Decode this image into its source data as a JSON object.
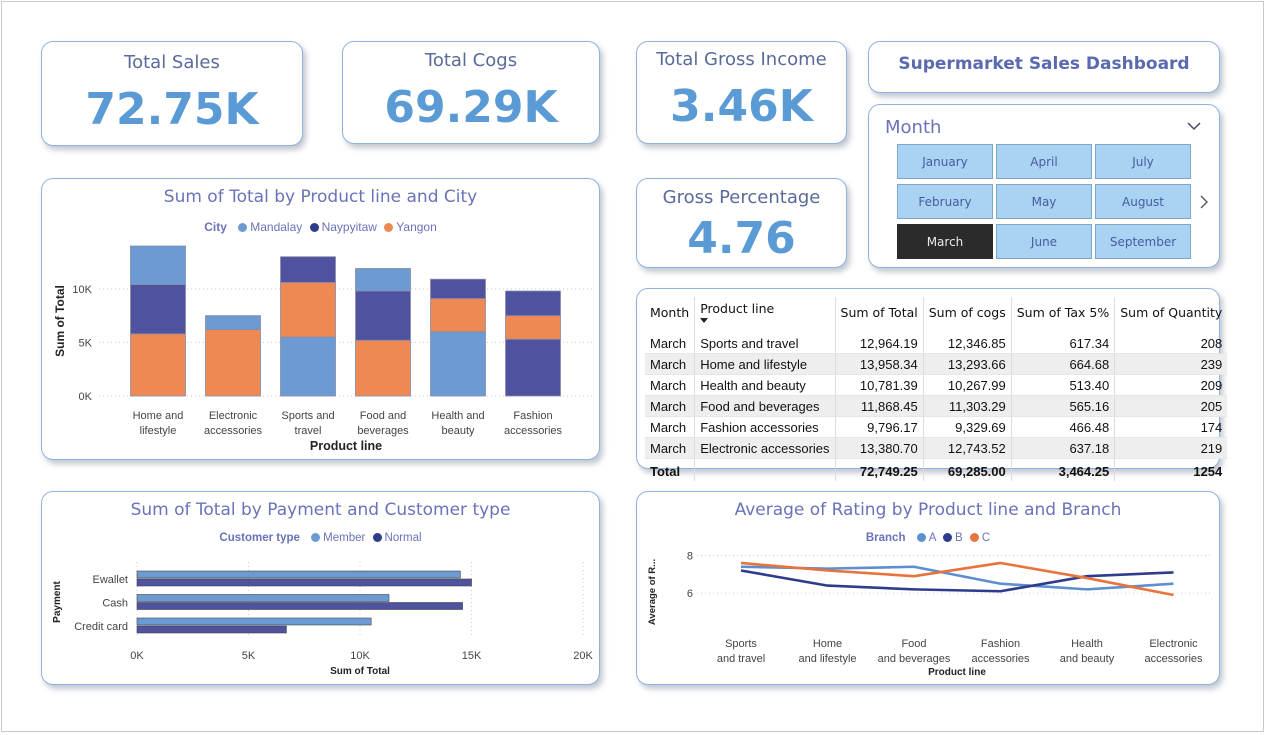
{
  "kpis": {
    "total_sales": {
      "title": "Total Sales",
      "value": "72.75K"
    },
    "total_cogs": {
      "title": "Total Cogs",
      "value": "69.29K"
    },
    "total_gross_income": {
      "title": "Total Gross Income",
      "value": "3.46K"
    },
    "gross_percentage": {
      "title": "Gross Percentage",
      "value": "4.76"
    }
  },
  "dashboard_title": "Supermarket Sales Dashboard",
  "slicer": {
    "title": "Month",
    "options": [
      "January",
      "April",
      "July",
      "February",
      "May",
      "August",
      "March",
      "June",
      "September"
    ],
    "selected": "March"
  },
  "colors": {
    "light_blue": "#6b9bd2",
    "navy": "#4f529f",
    "orange": "#ee8953",
    "line_a": "#5b8fd0",
    "line_b": "#2d3c8c",
    "line_c": "#e8733d"
  },
  "table": {
    "headers": [
      "Month",
      "Product line",
      "Sum of Total",
      "Sum of cogs",
      "Sum of Tax 5%",
      "Sum of Quantity"
    ],
    "rows": [
      [
        "March",
        "Sports and travel",
        "12,964.19",
        "12,346.85",
        "617.34",
        "208"
      ],
      [
        "March",
        "Home and lifestyle",
        "13,958.34",
        "13,293.66",
        "664.68",
        "239"
      ],
      [
        "March",
        "Health and beauty",
        "10,781.39",
        "10,267.99",
        "513.40",
        "209"
      ],
      [
        "March",
        "Food and beverages",
        "11,868.45",
        "11,303.29",
        "565.16",
        "205"
      ],
      [
        "March",
        "Fashion accessories",
        "9,796.17",
        "9,329.69",
        "466.48",
        "174"
      ],
      [
        "March",
        "Electronic accessories",
        "13,380.70",
        "12,743.52",
        "637.18",
        "219"
      ]
    ],
    "total": [
      "Total",
      "",
      "72,749.25",
      "69,285.00",
      "3,464.25",
      "1254"
    ]
  },
  "chart_data": [
    {
      "type": "bar",
      "stacked": true,
      "title": "Sum of Total by Product line and City",
      "legend_title": "City",
      "legend_position": "top",
      "categories": [
        "Home and lifestyle",
        "Electronic accessories",
        "Sports and travel",
        "Food and beverages",
        "Health and beauty",
        "Fashion accessories"
      ],
      "series": [
        {
          "name": "Yangon",
          "values": [
            5800,
            6200,
            0,
            5200,
            0,
            0
          ]
        },
        {
          "name": "Naypyitaw",
          "values": [
            4600,
            0,
            0,
            4600,
            0,
            5300
          ]
        },
        {
          "name": "Mandalay",
          "values": [
            3600,
            1300,
            0,
            2100,
            0,
            0
          ]
        },
        {
          "name": "Mandalay",
          "values": [
            0,
            0,
            5500,
            0,
            6000,
            0
          ]
        },
        {
          "name": "Yangon",
          "values": [
            0,
            0,
            5100,
            0,
            3100,
            2200
          ]
        },
        {
          "name": "Naypyitaw",
          "values": [
            0,
            0,
            2400,
            0,
            1800,
            2300
          ]
        }
      ],
      "xlabel": "Product line",
      "ylabel": "Sum of Total",
      "yticks": [
        "0K",
        "5K",
        "10K"
      ],
      "ylim": [
        0,
        14000
      ],
      "grid": true
    },
    {
      "type": "bar",
      "orientation": "horizontal",
      "title": "Sum of Total by Payment and Customer type",
      "legend_title": "Customer type",
      "legend_position": "top",
      "categories": [
        "Ewallet",
        "Cash",
        "Credit card"
      ],
      "series": [
        {
          "name": "Member",
          "values": [
            14500,
            11300,
            10500
          ]
        },
        {
          "name": "Normal",
          "values": [
            15000,
            14600,
            6700
          ]
        }
      ],
      "xlabel": "Sum of Total",
      "ylabel": "Payment",
      "xticks": [
        "0K",
        "5K",
        "10K",
        "15K",
        "20K"
      ],
      "xlim": [
        0,
        20000
      ],
      "grid": true
    },
    {
      "type": "line",
      "title": "Average of Rating by Product line and Branch",
      "legend_title": "Branch",
      "legend_position": "top",
      "categories": [
        "Sports and travel",
        "Home and lifestyle",
        "Food and beverages",
        "Fashion accessories",
        "Health and beauty",
        "Electronic accessories"
      ],
      "series": [
        {
          "name": "A",
          "values": [
            7.4,
            7.3,
            7.4,
            6.5,
            6.2,
            6.5
          ]
        },
        {
          "name": "B",
          "values": [
            7.2,
            6.4,
            6.2,
            6.1,
            6.9,
            7.1
          ]
        },
        {
          "name": "C",
          "values": [
            7.6,
            7.2,
            6.9,
            7.6,
            6.8,
            5.9
          ]
        }
      ],
      "xlabel": "Product line",
      "ylabel": "Average of R...",
      "yticks": [
        "6",
        "8"
      ],
      "ylim": [
        5,
        8.5
      ],
      "grid": true
    }
  ]
}
